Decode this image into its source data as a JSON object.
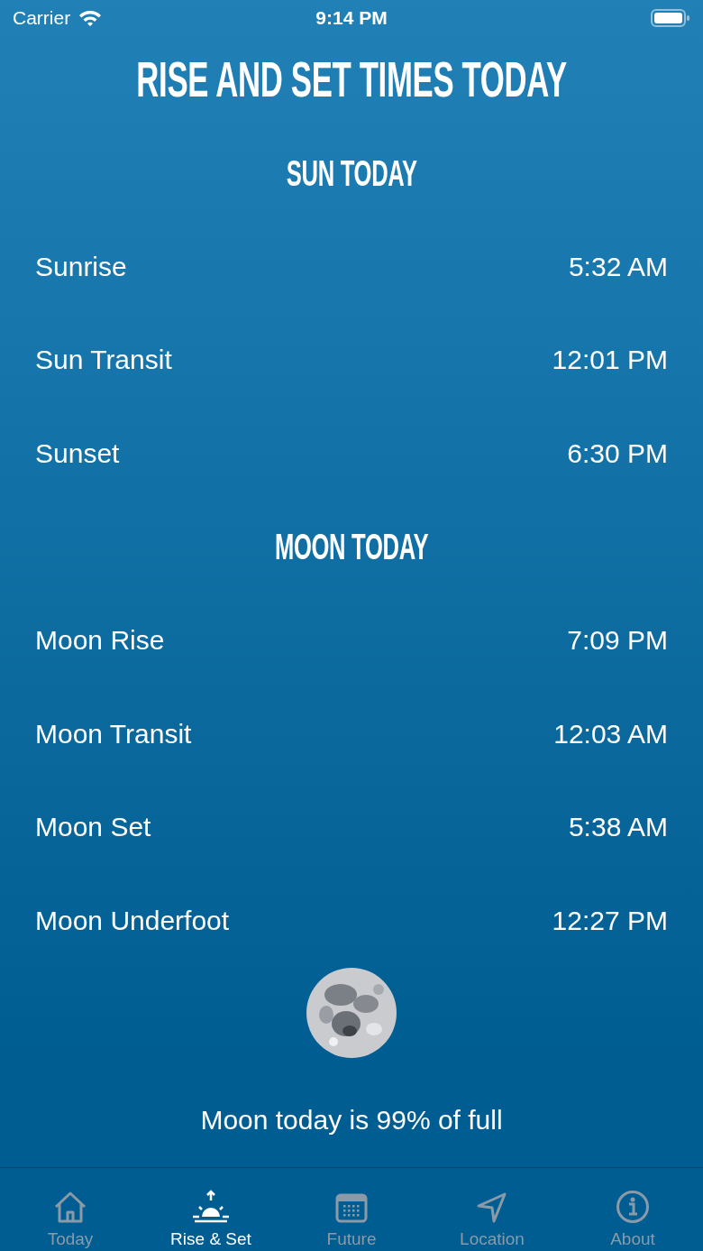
{
  "status_bar": {
    "carrier": "Carrier",
    "time": "9:14 PM"
  },
  "title": "RISE AND SET TIMES TODAY",
  "sections": [
    {
      "heading": "SUN TODAY",
      "rows": [
        {
          "label": "Sunrise",
          "time": "5:32 AM"
        },
        {
          "label": "Sun Transit",
          "time": "12:01 PM"
        },
        {
          "label": "Sunset",
          "time": "6:30 PM"
        }
      ]
    },
    {
      "heading": "MOON TODAY",
      "rows": [
        {
          "label": "Moon Rise",
          "time": "7:09 PM"
        },
        {
          "label": "Moon Transit",
          "time": "12:03 AM"
        },
        {
          "label": "Moon Set",
          "time": "5:38 AM"
        },
        {
          "label": "Moon Underfoot",
          "time": "12:27 PM"
        }
      ]
    }
  ],
  "moon": {
    "kind": "picture",
    "caption": "Moon today is 99% of full"
  },
  "tabs": [
    {
      "label": "Today",
      "kind": "home",
      "selected": false
    },
    {
      "label": "Rise & Set",
      "kind": "sunrise",
      "selected": true
    },
    {
      "label": "Future",
      "kind": "calendar",
      "selected": false
    },
    {
      "label": "Location",
      "kind": "location",
      "selected": false
    },
    {
      "label": "About",
      "kind": "info",
      "selected": false
    }
  ]
}
